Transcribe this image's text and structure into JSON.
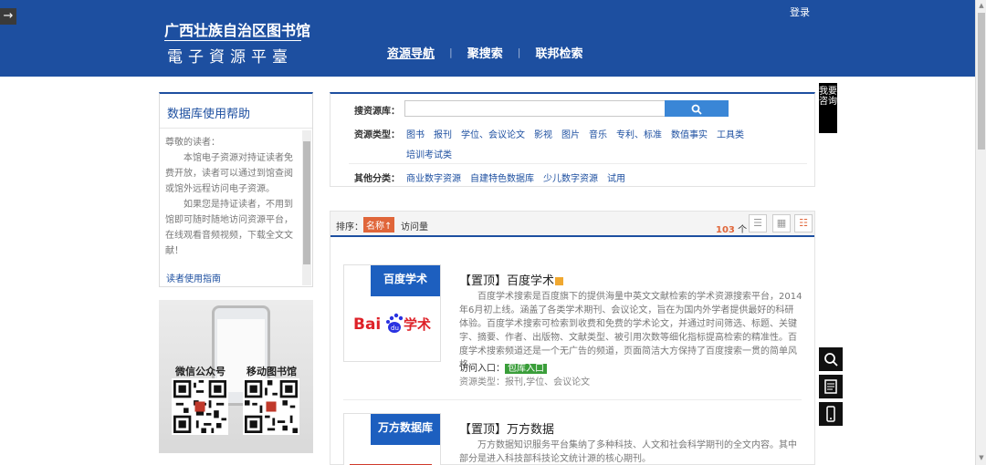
{
  "header": {
    "exit_icon": "arrow-right-icon",
    "logo_title": "广西壮族自治区图书馆",
    "logo_subtitle": "電子資源平臺",
    "login": "登录",
    "nav": [
      "资源导航",
      "聚搜索",
      "联邦检索"
    ]
  },
  "sidebar": {
    "help_title": "数据库使用帮助",
    "help_greeting": "尊敬的读者：",
    "help_p1": "本馆电子资源对持证读者免费开放，读者可以通过到馆查阅或馆外远程访问电子资源。",
    "help_p2": "如果您是持证读者，不用到馆即可随时随地访问资源平台，在线观看音频视频，下载全文文献！",
    "help_link": "读者使用指南",
    "qr_label_1": "微信公众号",
    "qr_label_2": "移动图书馆"
  },
  "search": {
    "label_db": "搜资源库：",
    "label_type": "资源类型：",
    "types": [
      "图书",
      "报刊",
      "学位、会议论文",
      "影视",
      "图片",
      "音乐",
      "专利、标准",
      "数值事实",
      "工具类"
    ],
    "types_row2": "培训考试类",
    "label_other": "其他分类：",
    "others": [
      "商业数字资源",
      "自建特色数据库",
      "少儿数字资源",
      "试用"
    ],
    "search_icon": "search-icon"
  },
  "results": {
    "sort_label": "排序：",
    "sort_active": "名称↑",
    "sort_visit": "访问量",
    "count_num": "103",
    "count_unit": "个",
    "items": [
      {
        "badge": "百度学术",
        "title": "【置顶】百度学术",
        "desc": "百度学术搜索是百度旗下的提供海量中英文文献检索的学术资源搜索平台，2014年6月初上线。涵盖了各类学术期刊、会议论文，旨在为国内外学者提供最好的科研体验。百度学术搜索可检索到收费和免费的学术论文，并通过时间筛选、标题、关键字、摘要、作者、出版物、文献类型、被引用次数等细化指标提高检索的精准性。百度学术搜索频道还是一个无广告的频道，页面简洁大方保持了百度搜索一贯的简单风格。",
        "entry_label": "访问入口：",
        "entry_tag": "包库入口",
        "type": "资源类型：报刊,学位、会议论文"
      },
      {
        "badge": "万方数据库",
        "title": "【置顶】万方数据",
        "desc": "万方数据知识服务平台集纳了多种科技、人文和社会科学期刊的全文内容。其中部分是进入科技部科技论文统计源的核心期刊。"
      }
    ]
  },
  "floating": {
    "consult": "我要咨询",
    "icons": [
      "search-icon",
      "document-icon",
      "mobile-icon"
    ]
  },
  "colors": {
    "brand": "#1d4fa0",
    "accent": "#e0663a",
    "button": "#3a86d6",
    "tag_green": "#3a9e3a"
  }
}
